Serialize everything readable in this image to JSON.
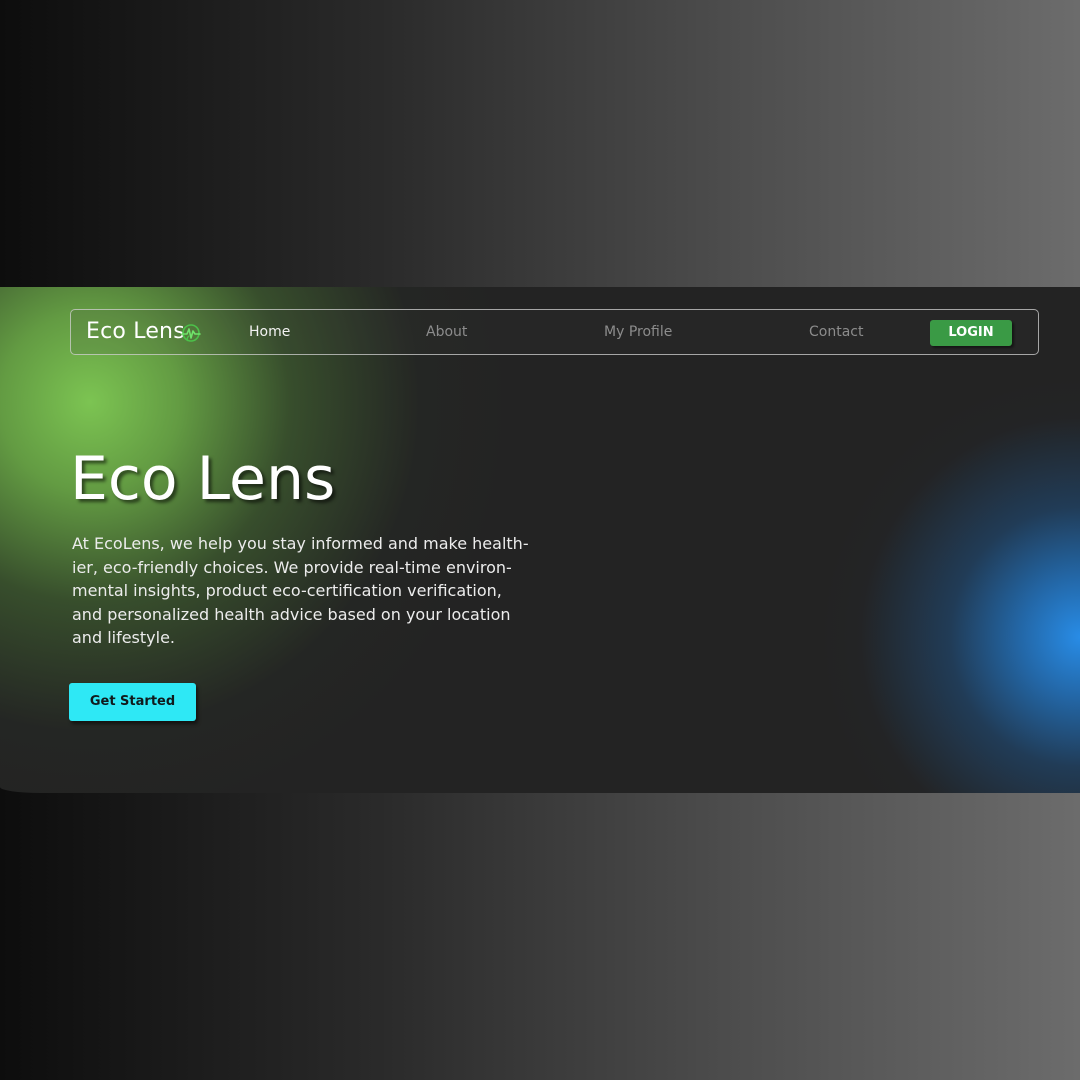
{
  "brand": {
    "name": "Eco Lens",
    "accent": "#3a9a45",
    "logo_icon": "heartbeat-leaf-icon"
  },
  "nav": {
    "items": [
      {
        "label": "Home",
        "active": true
      },
      {
        "label": "About",
        "active": false
      },
      {
        "label": "My Profile",
        "active": false
      },
      {
        "label": "Contact",
        "active": false
      }
    ],
    "login_label": "LOGIN"
  },
  "hero": {
    "title": "Eco Lens",
    "description_lines": [
      "At EcoLens, we help you stay informed and make health-",
      "ier, eco-friendly choices. We provide real-time environ-",
      "mental insights, product eco-certification verification,",
      "and personalized health advice based on your location",
      "and lifestyle."
    ],
    "cta_label": "Get Started",
    "cta_color": "#2ee8f5"
  }
}
